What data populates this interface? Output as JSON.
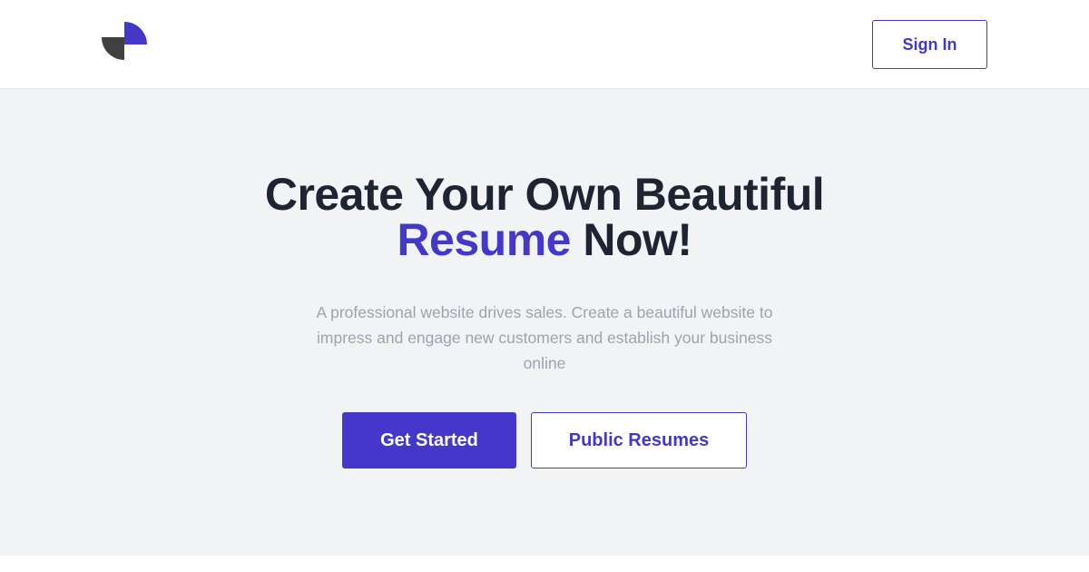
{
  "header": {
    "logo_icon": "quarter-circles-logo-icon",
    "signin_label": "Sign In"
  },
  "hero": {
    "headline_line1": "Create Your Own Beautiful",
    "headline_accent": "Resume",
    "headline_rest": " Now!",
    "subtext": "A professional website drives sales. Create a beautiful website to impress and engage new customers and establish your business online",
    "primary_cta": "Get Started",
    "secondary_cta": "Public Resumes"
  },
  "colors": {
    "accent": "#4338ca",
    "heading": "#1e2432",
    "muted_text": "#9ca3af",
    "hero_background": "#f2f3f5",
    "logo_dark": "#404040"
  }
}
